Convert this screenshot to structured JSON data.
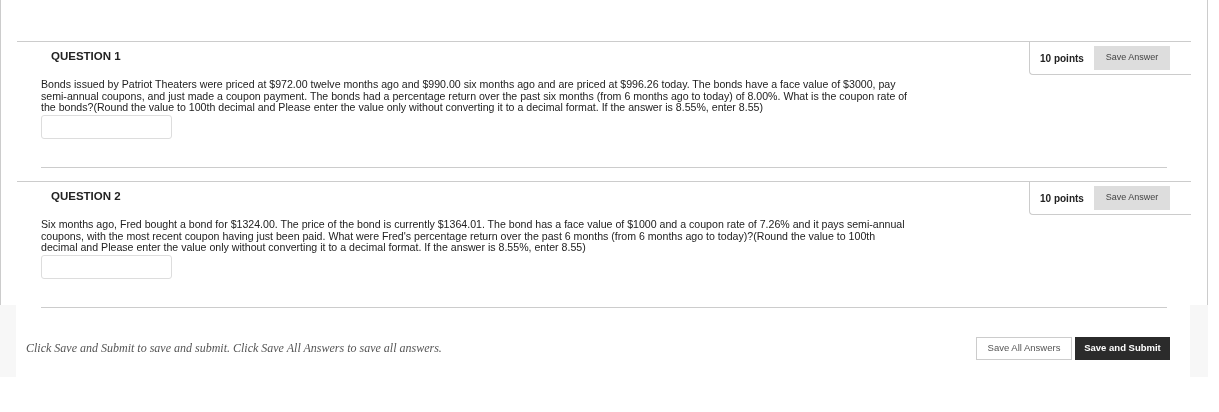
{
  "questions": [
    {
      "title": "QUESTION 1",
      "points": "10 points",
      "save_button": "Save Answer",
      "text": "Bonds issued by Patriot Theaters were priced at $972.00 twelve months ago and $990.00 six months ago and are priced at $996.26 today. The bonds have a face value of $3000, pay semi-annual coupons, and just made a coupon payment. The bonds had a percentage return over the past six months (from 6 months ago to today) of 8.00%. What is the coupon rate of the bonds?(Round the value to 100th decimal and Please enter the value only without converting it to a decimal format. If the answer is 8.55%, enter 8.55)"
    },
    {
      "title": "QUESTION 2",
      "points": "10 points",
      "save_button": "Save Answer",
      "text": "Six months ago, Fred bought a bond for $1324.00. The price of the bond is currently $1364.01. The bond has a face value of $1000 and a coupon rate of 7.26% and it pays semi-annual coupons, with the most recent coupon having just been paid. What were Fred's percentage return over the past 6 months (from 6 months ago to today)?(Round the value to 100th decimal and Please enter the value only without converting it to a decimal format. If the answer is 8.55%, enter 8.55)"
    }
  ],
  "footer": {
    "instructions": "Click Save and Submit to save and submit. Click Save All Answers to save all answers.",
    "save_all_button": "Save All Answers",
    "submit_button": "Save and Submit"
  }
}
